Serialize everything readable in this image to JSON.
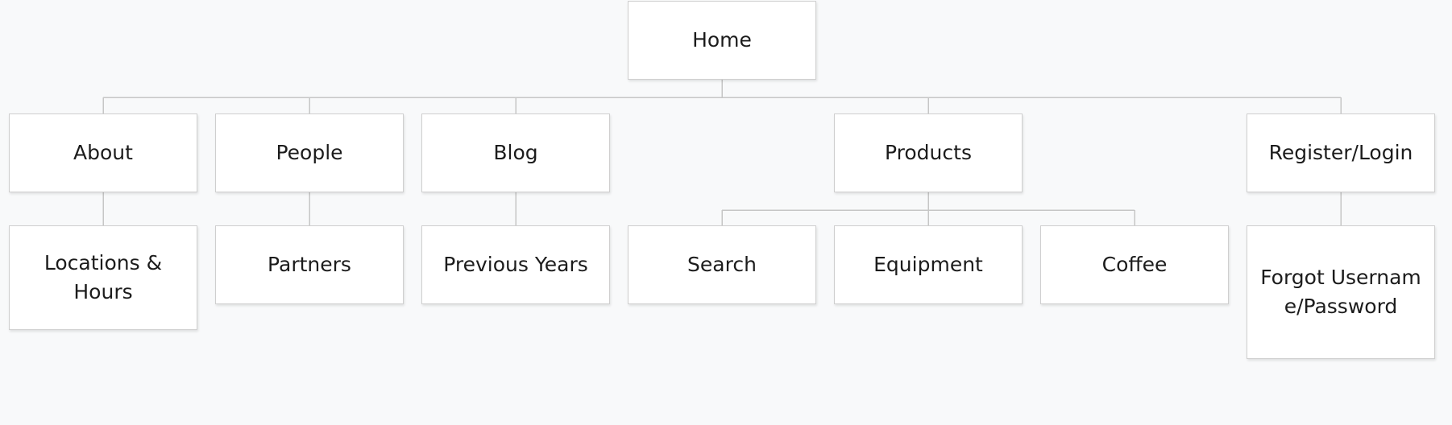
{
  "sitemap": {
    "root": {
      "label": "Home"
    },
    "sections": [
      {
        "label": "About",
        "children": [
          {
            "label": "Locations & Hours"
          }
        ]
      },
      {
        "label": "People",
        "children": [
          {
            "label": "Partners"
          }
        ]
      },
      {
        "label": "Blog",
        "children": [
          {
            "label": "Previous Years"
          }
        ]
      },
      {
        "label": "Products",
        "children": [
          {
            "label": "Search"
          },
          {
            "label": "Equipment"
          },
          {
            "label": "Coffee"
          }
        ]
      },
      {
        "label": "Register/Login",
        "children": [
          {
            "label": "Forgot Username/Password"
          }
        ]
      }
    ]
  },
  "colors": {
    "background": "#f8f9fa",
    "node_fill": "#ffffff",
    "node_border": "#cfcfcf",
    "connector": "#c6c6c6",
    "text": "#1c1c1c"
  }
}
